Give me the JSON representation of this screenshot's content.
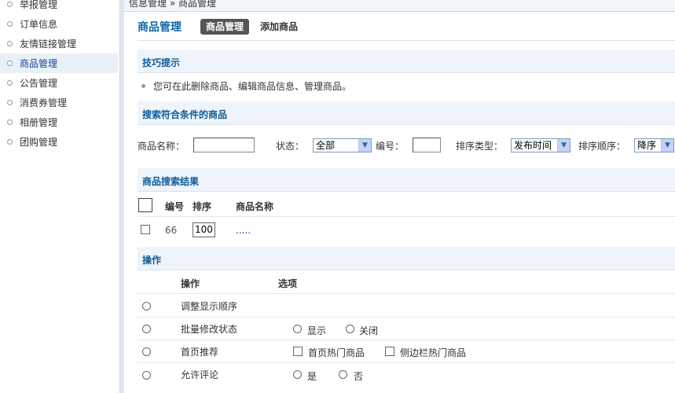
{
  "breadcrumb": "信息管理 » 商品管理",
  "sidebar": {
    "items": [
      {
        "label": "举报管理",
        "active": false
      },
      {
        "label": "订单信息",
        "active": false
      },
      {
        "label": "友情链接管理",
        "active": false
      },
      {
        "label": "商品管理",
        "active": true
      },
      {
        "label": "公告管理",
        "active": false
      },
      {
        "label": "消费券管理",
        "active": false
      },
      {
        "label": "相册管理",
        "active": false
      },
      {
        "label": "团购管理",
        "active": false
      }
    ]
  },
  "page": {
    "title": "商品管理",
    "tabs": [
      {
        "label": "商品管理",
        "active": true
      },
      {
        "label": "添加商品",
        "active": false
      }
    ]
  },
  "tips": {
    "header": "技巧提示",
    "text": "您可在此删除商品、编辑商品信息、管理商品。"
  },
  "search": {
    "header": "搜索符合条件的商品",
    "name_label": "商品名称：",
    "name_value": "",
    "status_label": "状态：",
    "status_value": "全部",
    "id_label": "编号：",
    "id_value": "",
    "sort_type_label": "排序类型：",
    "sort_type_value": "发布时间",
    "sort_order_label": "排序顺序：",
    "sort_order_value": "降序"
  },
  "results": {
    "header": "商品搜索结果",
    "columns": [
      "编号",
      "排序",
      "商品名称"
    ],
    "rows": [
      {
        "id": "66",
        "order": "100",
        "name": "....."
      }
    ]
  },
  "operations": {
    "header": "操作",
    "col_action": "操作",
    "col_option": "选项",
    "rows": [
      {
        "label": "调整显示顺序"
      },
      {
        "label": "批量修改状态",
        "options": [
          "显示",
          "关闭"
        ]
      },
      {
        "label": "首页推荐",
        "options": [
          "首页热门商品",
          "侧边栏热门商品"
        ]
      },
      {
        "label": "允许评论",
        "options": [
          "是",
          "否"
        ]
      }
    ]
  },
  "colors": {
    "accent": "#0f67a8",
    "section_bg": "#eef4fa",
    "sidebar_active_bg": "#e8f0f8"
  }
}
